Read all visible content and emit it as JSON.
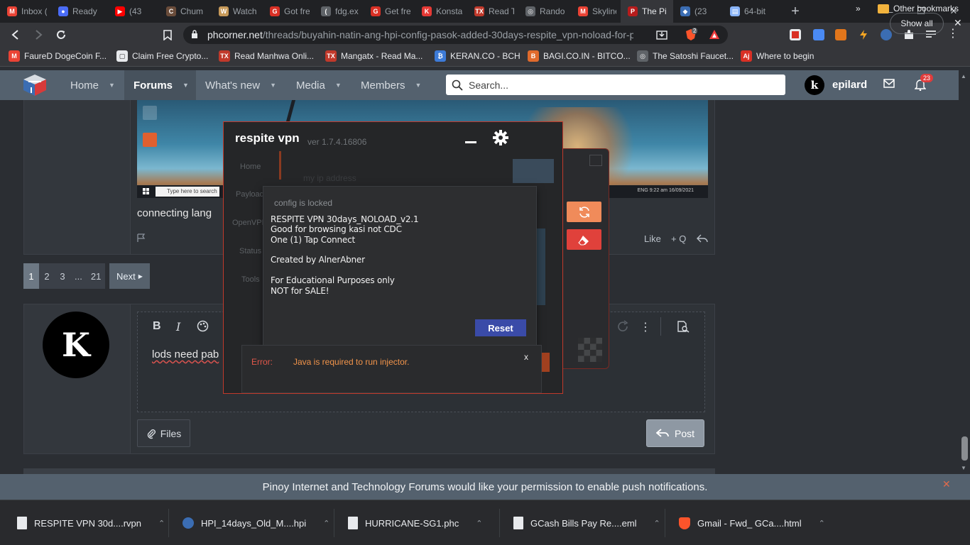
{
  "browser": {
    "tabs": [
      {
        "label": "Inbox (",
        "icon": "gmail-icon",
        "color": "#ea4335",
        "glyph": "M"
      },
      {
        "label": "Ready",
        "icon": "firefox-icon",
        "color": "#4a6cf7",
        "glyph": "●"
      },
      {
        "label": "(43",
        "icon": "youtube-icon",
        "color": "#ff0000",
        "glyph": "▶"
      },
      {
        "label": "Chum",
        "icon": "chum-icon",
        "color": "#6a4c3a",
        "glyph": "C"
      },
      {
        "label": "Watch",
        "icon": "watch-icon",
        "color": "#c79a5a",
        "glyph": "W"
      },
      {
        "label": "Got fre",
        "icon": "gotfree-icon",
        "color": "#d93025",
        "glyph": "G"
      },
      {
        "label": "fdg.ex",
        "icon": "fdg-icon",
        "color": "#5f6368",
        "glyph": "("
      },
      {
        "label": "Get fre",
        "icon": "getfree-icon",
        "color": "#d93025",
        "glyph": "G"
      },
      {
        "label": "Konsta",
        "icon": "konsta-icon",
        "color": "#e53935",
        "glyph": "K"
      },
      {
        "label": "Read T",
        "icon": "tx-icon",
        "color": "#c0392b",
        "glyph": "TX"
      },
      {
        "label": "Rando",
        "icon": "globe-icon",
        "color": "#5f6368",
        "glyph": "◎"
      },
      {
        "label": "Skyline",
        "icon": "gmail-icon",
        "color": "#ea4335",
        "glyph": "M"
      },
      {
        "label": "The Pi",
        "icon": "pi-icon",
        "color": "#b71c1c",
        "glyph": "P"
      },
      {
        "label": "(23",
        "icon": "phcorner-icon",
        "color": "#3b6db3",
        "glyph": "◆"
      },
      {
        "label": "64-bit",
        "icon": "doc-icon",
        "color": "#8ab4f8",
        "glyph": "▤"
      }
    ],
    "new_tab": "+",
    "window": {
      "minimize": "—",
      "restore": "❐",
      "close": "✕"
    },
    "url_domain": "phcorner.net",
    "url_path": "/threads/buyahin-natin-ang-hpi-config-pasok-added-30days-respite_vpn-noload-for-p...",
    "brave_badge": "2",
    "bookmarks": [
      {
        "label": "FaureD DogeCoin F...",
        "icon": "gmail-icon",
        "color": "#ea4335",
        "glyph": "M"
      },
      {
        "label": "Claim Free Crypto...",
        "icon": "doc-icon",
        "color": "#e8eaed",
        "glyph": "▢"
      },
      {
        "label": "Read Manhwa Onli...",
        "icon": "tx-icon",
        "color": "#c0392b",
        "glyph": "TX"
      },
      {
        "label": "Mangatx - Read Ma...",
        "icon": "tx-icon",
        "color": "#c0392b",
        "glyph": "TX"
      },
      {
        "label": "KERAN.CO - BCH",
        "icon": "keran-icon",
        "color": "#3d7bd8",
        "glyph": "₿"
      },
      {
        "label": "BAGI.CO.IN - BITCO...",
        "icon": "bagi-icon",
        "color": "#e06a2c",
        "glyph": "B"
      },
      {
        "label": "The Satoshi Faucet...",
        "icon": "globe-icon",
        "color": "#5f6368",
        "glyph": "◎"
      },
      {
        "label": "Where to begin",
        "icon": "aj-icon",
        "color": "#d93025",
        "glyph": "Aj"
      }
    ],
    "bookmarks_more": "»",
    "other_bookmarks": "Other bookmarks"
  },
  "forum": {
    "nav": [
      {
        "label": "Home",
        "active": false
      },
      {
        "label": "Forums",
        "active": true
      },
      {
        "label": "What's new",
        "active": false
      },
      {
        "label": "Media",
        "active": false
      },
      {
        "label": "Members",
        "active": false
      }
    ],
    "search_placeholder": "Search...",
    "user_initial": "k",
    "username": "epilard",
    "alert_count": "23",
    "post": {
      "text": "connecting lang",
      "like": "Like",
      "quote": "+ Q",
      "reply": "⟲"
    },
    "screenshot": {
      "taskbar_search": "Type here to search",
      "tray_text": "ENG  9:22 am  16/09/2021"
    },
    "pager": {
      "pages": [
        "1",
        "2",
        "3",
        "...",
        "21"
      ],
      "current": "1",
      "next": "Next"
    },
    "reply": {
      "avatar_initial": "K",
      "editor_text": "lods need pab",
      "files": "Files",
      "post": "Post"
    },
    "push_notice": "Pinoy Internet and Technology Forums would like your permission to enable push notifications."
  },
  "vpn": {
    "title": "respite vpn",
    "version": "ver 1.7.4.16806",
    "sidebar": [
      "Home",
      "Payload",
      "OpenVPN",
      "Status",
      "Tools"
    ],
    "ip_placeholder": "my ip address",
    "config": {
      "title": "config is locked",
      "lines": [
        "RESPITE VPN 30days_NOLOAD_v2.1",
        "Good for browsing kasi not CDC",
        "One (1) Tap Connect",
        "",
        "Created by AlnerAbner",
        "",
        "For Educational Purposes only",
        "NOT for SALE!"
      ],
      "reset": "Reset"
    },
    "error": {
      "label": "Error:",
      "message": "Java is required to run injector.",
      "close": "x"
    }
  },
  "downloads": {
    "items": [
      {
        "name": "RESPITE VPN 30d....rvpn",
        "icon": "doc-icon"
      },
      {
        "name": "HPI_14days_Old_M....hpi",
        "icon": "hpi-icon"
      },
      {
        "name": "HURRICANE-SG1.phc",
        "icon": "doc-icon"
      },
      {
        "name": "GCash Bills Pay Re....eml",
        "icon": "doc-icon"
      },
      {
        "name": "Gmail - Fwd_ GCa....html",
        "icon": "brave-icon"
      }
    ],
    "show_all": "Show all",
    "close": "✕"
  }
}
